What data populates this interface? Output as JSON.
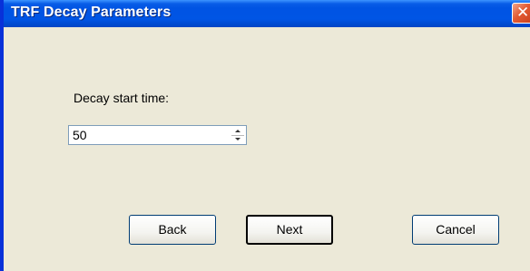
{
  "window": {
    "title": "TRF Decay Parameters",
    "close_glyph": "✕",
    "close_icon": "close-icon"
  },
  "form": {
    "decay_label": "Decay start time:",
    "decay_value": "50"
  },
  "buttons": {
    "back": "Back",
    "next": "Next",
    "cancel": "Cancel"
  },
  "colors": {
    "titlebar": "#0054e3",
    "window_bg": "#ece9d8",
    "close_button": "#e35a32"
  }
}
